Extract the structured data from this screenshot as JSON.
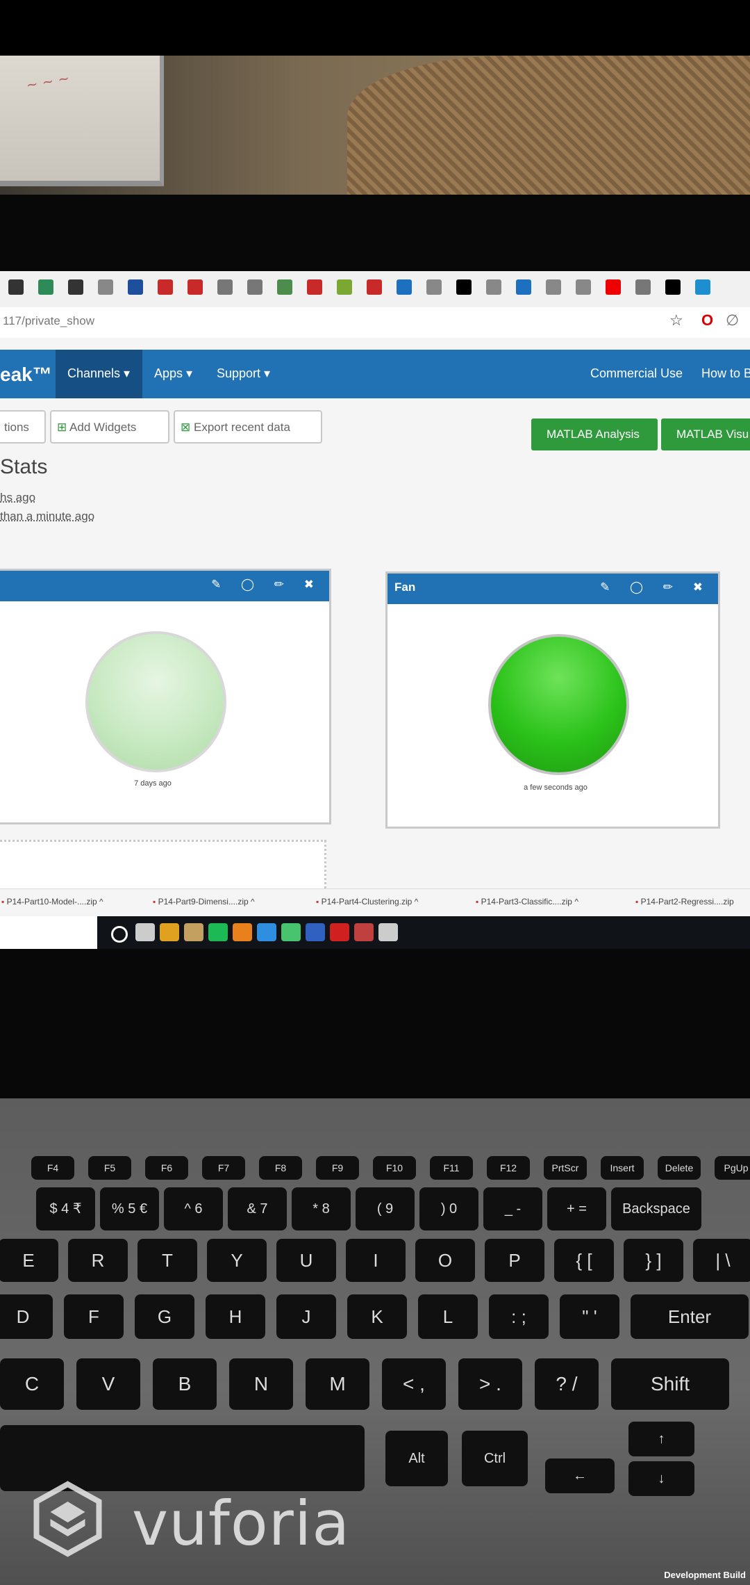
{
  "bookmarks_colors": [
    "#333",
    "#2e8b57",
    "#333",
    "#888",
    "#1d4f9c",
    "#c82a2a",
    "#c82a2a",
    "#777",
    "#777",
    "#4c8c4c",
    "#c82a2a",
    "#7aa830",
    "#c82a2a",
    "#1d6fc0",
    "#888",
    "#000",
    "#888",
    "#1d6fc0",
    "#888",
    "#888",
    "#e00",
    "#777",
    "#000",
    "#1d8fd0"
  ],
  "browser": {
    "url": "117/private_show",
    "star_icon": "star-icon",
    "opera_icon": "opera-icon"
  },
  "nav": {
    "brand": "eak™",
    "channels": "Channels ▾",
    "apps": "Apps ▾",
    "support": "Support ▾",
    "commercial": "Commercial Use",
    "howto": "How to B"
  },
  "toolbar": {
    "partial_label": "tions",
    "add_widgets": "Add Widgets",
    "export": "Export recent data",
    "matlab_analysis": "MATLAB Analysis",
    "matlab_visu": "MATLAB Visu"
  },
  "stats": {
    "title": "Stats",
    "created": "hs ago",
    "updated": "than a minute ago"
  },
  "widgets": [
    {
      "title": "",
      "time": "7 days ago",
      "state": "off",
      "color": "#c9eac4"
    },
    {
      "title": "Fan",
      "time": "a few seconds ago",
      "state": "on",
      "color": "#2bc21a"
    }
  ],
  "widget_tools": "✎ ◯ ✏ ✖",
  "downloads": [
    "P14-Part10-Model-....zip",
    "P14-Part9-Dimensi....zip",
    "P14-Part4-Clustering.zip",
    "P14-Part3-Classific....zip",
    "P14-Part2-Regressi....zip"
  ],
  "taskbar_colors": [
    "#ffffff",
    "#cccccc",
    "#e0a020",
    "#c4a060",
    "#1db954",
    "#e8801c",
    "#2f8ee0",
    "#49c46e",
    "#3060c0",
    "#d02020",
    "#c04040",
    "#cccccc"
  ],
  "keyboard": {
    "frow": [
      "F4",
      "F5",
      "F6",
      "F7",
      "F8",
      "F9",
      "F10",
      "F11",
      "F12",
      "PrtScr",
      "Insert",
      "Delete",
      "PgUp"
    ],
    "numrow": [
      "$ 4 ₹",
      "% 5 €",
      "^ 6",
      "& 7",
      "* 8",
      "( 9",
      ") 0",
      "_ -",
      "+ =",
      "Backspace"
    ],
    "qrow": [
      "E",
      "R",
      "T",
      "Y",
      "U",
      "I",
      "O",
      "P",
      "{ [",
      "} ]",
      "| \\"
    ],
    "arow": [
      "D",
      "F",
      "G",
      "H",
      "J",
      "K",
      "L",
      ": ;",
      "\" '",
      "Enter"
    ],
    "zrow": [
      "C",
      "V",
      "B",
      "N",
      "M",
      "< ,",
      "> .",
      "? /",
      "Shift"
    ],
    "bottom": [
      "Alt",
      "Ctrl",
      "←",
      "↑",
      "↓"
    ]
  },
  "watermark": {
    "text": "vuforia",
    "tm": "™"
  },
  "build_label": "Development Build"
}
